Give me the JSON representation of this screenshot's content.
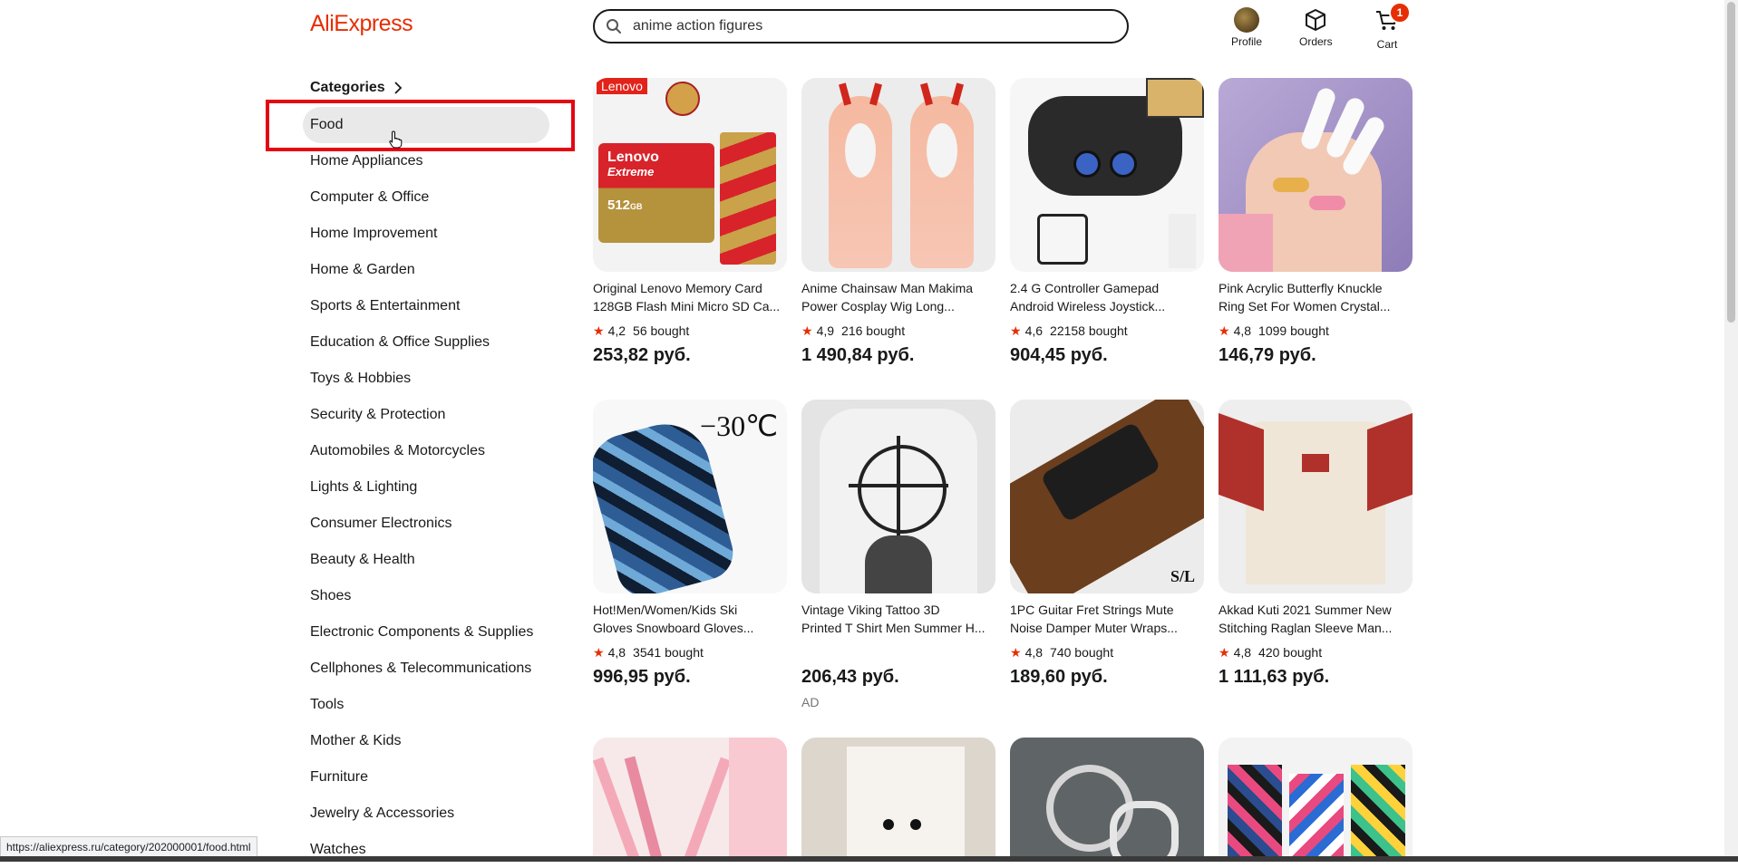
{
  "header": {
    "logo": "AliExpress",
    "search_value": "anime action figures",
    "profile_label": "Profile",
    "orders_label": "Orders",
    "cart_label": "Cart",
    "cart_count": "1"
  },
  "categories": {
    "title": "Categories",
    "items": [
      "Food",
      "Home Appliances",
      "Computer & Office",
      "Home Improvement",
      "Home & Garden",
      "Sports & Entertainment",
      "Education & Office Supplies",
      "Toys & Hobbies",
      "Security & Protection",
      "Automobiles & Motorcycles",
      "Lights & Lighting",
      "Consumer Electronics",
      "Beauty & Health",
      "Shoes",
      "Electronic Components & Supplies",
      "Cellphones & Telecommunications",
      "Tools",
      "Mother & Kids",
      "Furniture",
      "Jewelry & Accessories",
      "Watches"
    ]
  },
  "products": [
    {
      "line1": "Original Lenovo Memory Card",
      "line2": "128GB Flash Mini Micro SD Ca...",
      "rating": "4,2",
      "bought": "56 bought",
      "price": "253,82 руб.",
      "img_text": "Lenovo"
    },
    {
      "line1": "Anime Chainsaw Man Makima",
      "line2": "Power Cosplay Wig Long...",
      "rating": "4,9",
      "bought": "216 bought",
      "price": "1 490,84 руб."
    },
    {
      "line1": "2.4 G Controller Gamepad",
      "line2": "Android Wireless Joystick...",
      "rating": "4,6",
      "bought": "22158 bought",
      "price": "904,45 руб."
    },
    {
      "line1": "Pink Acrylic Butterfly Knuckle",
      "line2": "Ring Set For Women Crystal...",
      "rating": "4,8",
      "bought": "1099 bought",
      "price": "146,79 руб."
    },
    {
      "line1": "Hot!Men/Women/Kids Ski",
      "line2": "Gloves Snowboard Gloves...",
      "rating": "4,8",
      "bought": "3541 bought",
      "price": "996,95 руб.",
      "img_text": "−30℃"
    },
    {
      "line1": "Vintage Viking Tattoo 3D",
      "line2": "Printed T Shirt Men Summer H...",
      "rating": "",
      "bought": "",
      "price": "206,43 руб.",
      "ad": "AD"
    },
    {
      "line1": "1PC Guitar Fret Strings Mute",
      "line2": "Noise Damper Muter Wraps...",
      "rating": "4,8",
      "bought": "740 bought",
      "price": "189,60 руб.",
      "img_text": "S/L"
    },
    {
      "line1": "Akkad Kuti 2021 Summer New",
      "line2": "Stitching Raglan Sleeve Man...",
      "rating": "4,8",
      "bought": "420 bought",
      "price": "1 111,63 руб."
    }
  ],
  "status_url": "https://aliexpress.ru/category/202000001/food.html",
  "colors": {
    "brand": "#e62e04",
    "highlight": "#e30613"
  }
}
